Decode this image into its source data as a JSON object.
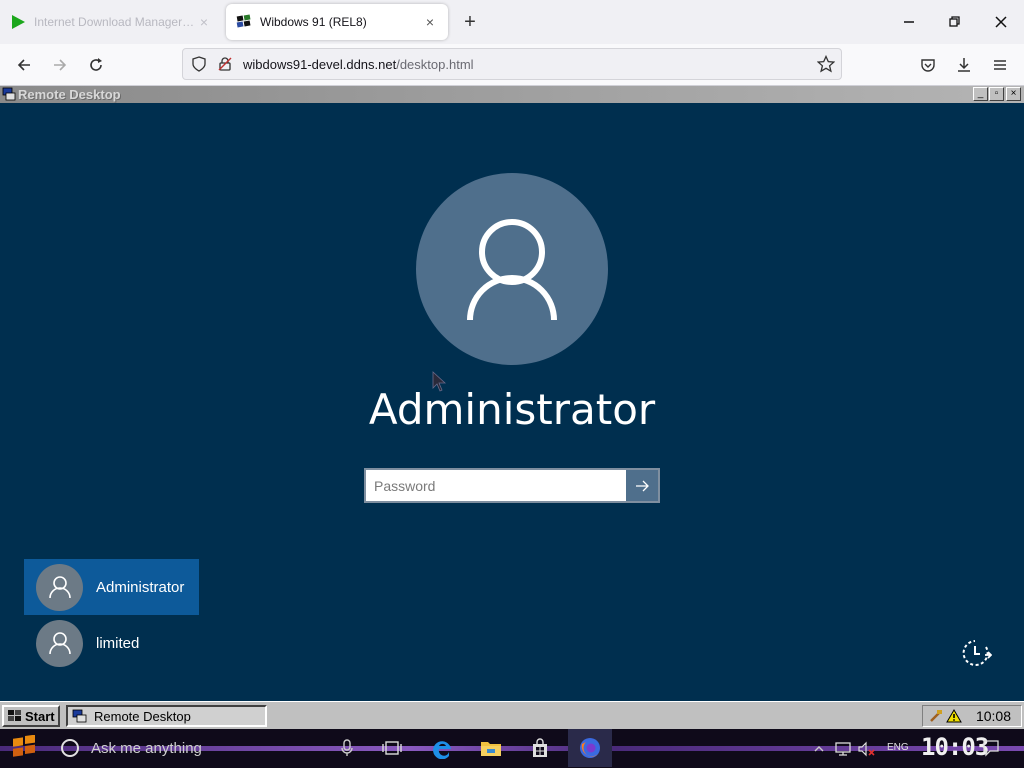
{
  "browser": {
    "tabs": [
      {
        "title": "Internet Download Manager: The fa",
        "active": false
      },
      {
        "title": "Wibdows 91 (REL8)",
        "active": true
      }
    ],
    "url_host": "wibdows91-devel.ddns.net",
    "url_path": "/desktop.html"
  },
  "remote_window": {
    "title": "Remote Desktop",
    "buttons": [
      "_",
      "▫",
      "×"
    ]
  },
  "login": {
    "username": "Administrator",
    "password_placeholder": "Password",
    "submit_arrow": "→",
    "users": [
      {
        "name": "Administrator",
        "selected": true
      },
      {
        "name": "limited",
        "selected": false
      }
    ]
  },
  "inner_taskbar": {
    "start_label": "Start",
    "task_label": "Remote Desktop",
    "clock": "10:08"
  },
  "host_taskbar": {
    "search_placeholder": "Ask me anything",
    "lang": "ENG",
    "clock": "10:03"
  },
  "colors": {
    "login_bg": "#002f4f",
    "accent": "#0d5a9a",
    "avatar": "#4f6f8c"
  }
}
